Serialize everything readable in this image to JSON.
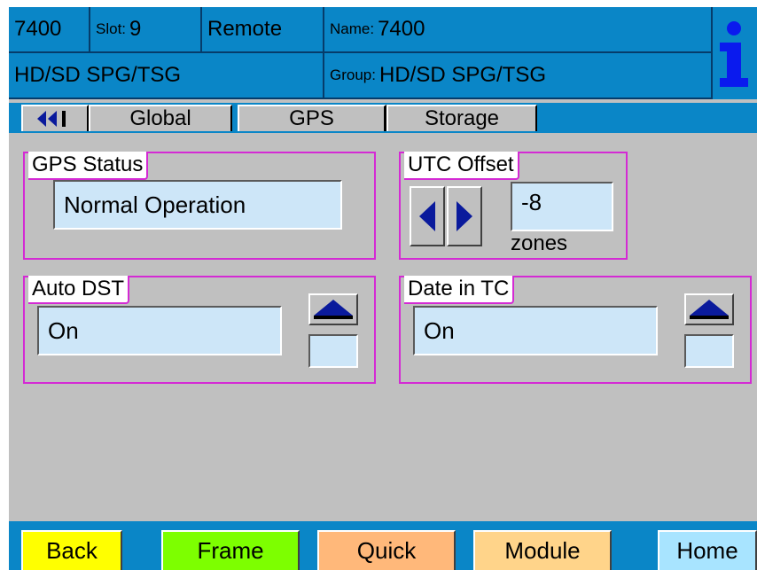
{
  "header": {
    "model": "7400",
    "slot_label": "Slot:",
    "slot_value": "9",
    "mode": "Remote",
    "name_label": "Name:",
    "name_value": "7400",
    "product": "HD/SD SPG/TSG",
    "group_label": "Group:",
    "group_value": "HD/SD SPG/TSG",
    "info_icon": "info-icon"
  },
  "tabs": {
    "back_arrow_icon": "double-left-arrow-icon",
    "items": [
      {
        "label": "Global"
      },
      {
        "label": "GPS"
      },
      {
        "label": "Storage"
      }
    ]
  },
  "panels": {
    "gps_status": {
      "title": "GPS Status",
      "value": "Normal Operation"
    },
    "utc_offset": {
      "title": "UTC Offset",
      "value": "-8",
      "unit": "zones"
    },
    "auto_dst": {
      "title": "Auto DST",
      "value": "On"
    },
    "date_in_tc": {
      "title": "Date in TC",
      "value": "On"
    }
  },
  "footer": {
    "back": "Back",
    "frame": "Frame",
    "quick": "Quick",
    "module": "Module",
    "home": "Home"
  },
  "colors": {
    "header_blue": "#0a86c7",
    "panel_border": "#d42ad4",
    "field_bg": "#cde6f8",
    "arrow_blue": "#0a1a9c",
    "back_btn": "#ffff00",
    "frame_btn": "#7dff00",
    "quick_btn": "#ffb87a",
    "module_btn": "#ffd48a",
    "home_btn": "#a8e4ff"
  }
}
